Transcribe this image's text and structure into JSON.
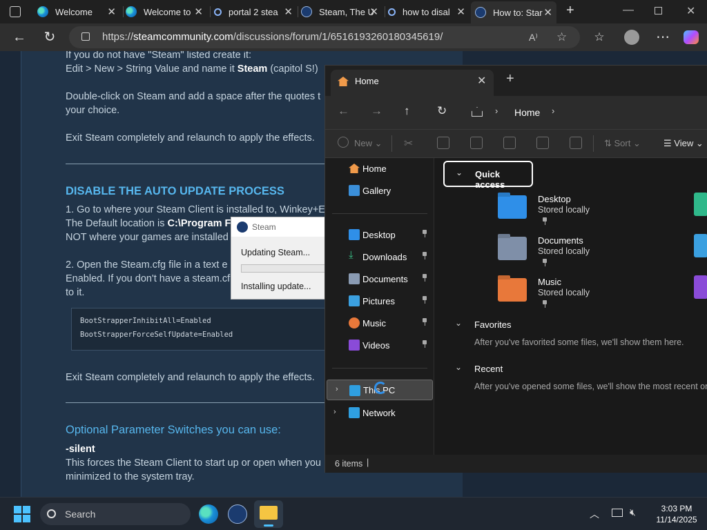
{
  "browser": {
    "tabs": [
      {
        "label": "Welcome",
        "icon": "edge-icon"
      },
      {
        "label": "Welcome to",
        "icon": "edge-icon"
      },
      {
        "label": "portal 2 stea",
        "icon": "search-icon"
      },
      {
        "label": "Steam, The U",
        "icon": "steam-icon"
      },
      {
        "label": "how to disal",
        "icon": "search-icon"
      },
      {
        "label": "How to: Star",
        "icon": "steam-icon"
      }
    ],
    "url_prefix": "https://",
    "url_host": "steamcommunity.com",
    "url_path": "/discussions/forum/1/651619326018034561​9/",
    "url_full": "https://steamcommunity.com/discussions/forum/1/6516193260180345619/"
  },
  "page": {
    "line1": "If you do not have \"Steam\" listed create it:",
    "line2_pre": "Edit > New > String Value and name it ",
    "line2_bold": "Steam",
    "line2_post": " (capitol S!)",
    "line3": "Double-click on Steam and add a space after the quotes t",
    "line4": "your choice.",
    "line5": "Exit Steam completely and relaunch to apply the effects.",
    "heading1": "DISABLE THE AUTO UPDATE PROCESS",
    "step1a": "1. Go to where your Steam Client is installed to, Winkey+E",
    "step1b_pre": "The Default location is ",
    "step1b_bold": "C:\\Program Fi",
    "step1c": "NOT where your games are installed",
    "step2a": "2. Open the Steam.cfg file in a text e",
    "step2b": "Enabled. If you don't have a steam.cf",
    "step2c": "to it.",
    "code1": "BootStrapperInhibitAll=Enabled",
    "code2": "BootStrapperForceSelfUpdate=Enabled",
    "line6": "Exit Steam completely and relaunch to apply the effects.",
    "heading2": "Optional Parameter Switches you can use:",
    "param": "-silent",
    "param_desc1": "This forces the Steam Client to start up or open when you",
    "param_desc2": "minimized to the system tray."
  },
  "steam_dialog": {
    "title": "Steam",
    "status": "Updating Steam...",
    "detail": "Installing update..."
  },
  "explorer": {
    "tab_title": "Home",
    "breadcrumb": "Home",
    "toolbar": {
      "new": "New",
      "sort": "Sort",
      "view": "View"
    },
    "sidebar": [
      {
        "label": "Home",
        "icon": "home-icon",
        "pinned": false
      },
      {
        "label": "Gallery",
        "icon": "gallery-icon",
        "pinned": false
      },
      {
        "label": "Desktop",
        "icon": "desktop-folder-icon",
        "pinned": true
      },
      {
        "label": "Downloads",
        "icon": "downloads-folder-icon",
        "pinned": true
      },
      {
        "label": "Documents",
        "icon": "documents-folder-icon",
        "pinned": true
      },
      {
        "label": "Pictures",
        "icon": "pictures-folder-icon",
        "pinned": true
      },
      {
        "label": "Music",
        "icon": "music-folder-icon",
        "pinned": true
      },
      {
        "label": "Videos",
        "icon": "videos-folder-icon",
        "pinned": true
      }
    ],
    "this_pc": "This PC",
    "network": "Network",
    "quick_access_label": "Quick access",
    "quick_access": [
      {
        "name": "Desktop",
        "sub": "Stored locally",
        "color": "#2f8fe8"
      },
      {
        "name": "Documents",
        "sub": "Stored locally",
        "color": "#7f8fa8"
      },
      {
        "name": "Music",
        "sub": "Stored locally",
        "color": "#e8783a"
      }
    ],
    "favorites_label": "Favorites",
    "favorites_note": "After you've favorited some files, we'll show them here.",
    "recent_label": "Recent",
    "recent_note": "After you've opened some files, we'll show the most recent ones",
    "status": "6 items"
  },
  "taskbar": {
    "search": "Search",
    "time": "3:03 PM",
    "date": "11/14/2025"
  },
  "colors": {
    "steam_bg": "#1b2838",
    "steam_link": "#57b7ee",
    "explorer_bg": "#1c1c1c",
    "accent": "#4cc2ff"
  }
}
